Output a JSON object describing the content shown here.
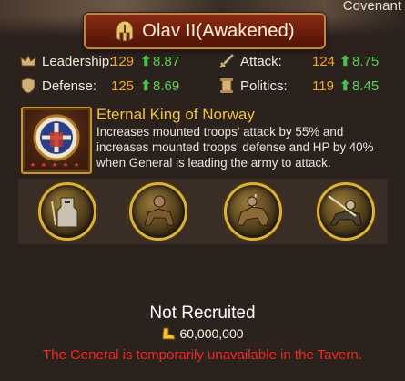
{
  "header": {
    "corner_label": "Covenant",
    "general_name": "Olav II(Awakened)",
    "icon": "helmet-icon"
  },
  "stats": {
    "leadership": {
      "label": "Leadership:",
      "value": "129",
      "increase": "8.87",
      "icon": "crown-icon"
    },
    "attack": {
      "label": "Attack:",
      "value": "124",
      "increase": "8.75",
      "icon": "sword-icon"
    },
    "defense": {
      "label": "Defense:",
      "value": "125",
      "increase": "8.69",
      "icon": "shield-icon"
    },
    "politics": {
      "label": "Politics:",
      "value": "119",
      "increase": "8.45",
      "icon": "scroll-icon"
    },
    "increase_arrow": "⬆"
  },
  "skill": {
    "title": "Eternal King of Norway",
    "description": "Increases mounted troops' attack by 55% and increases mounted troops' defense and HP by 40% when General is leading the army to attack.",
    "icon": "coat-of-arms-icon",
    "stars": 5
  },
  "troops": [
    {
      "icon": "knight-icon"
    },
    {
      "icon": "horseman-icon"
    },
    {
      "icon": "cavalry-icon"
    },
    {
      "icon": "lancer-icon"
    }
  ],
  "recruit": {
    "status": "Not Recruited",
    "cost": "60,000,000",
    "cost_icon": "gold-boot-icon",
    "warning": "The General is temporarily unavailable in the Tavern."
  },
  "colors": {
    "accent_gold": "#f3c240",
    "value_orange": "#f0a72c",
    "increase_green": "#55d155",
    "warning_red": "#ee2a22"
  }
}
